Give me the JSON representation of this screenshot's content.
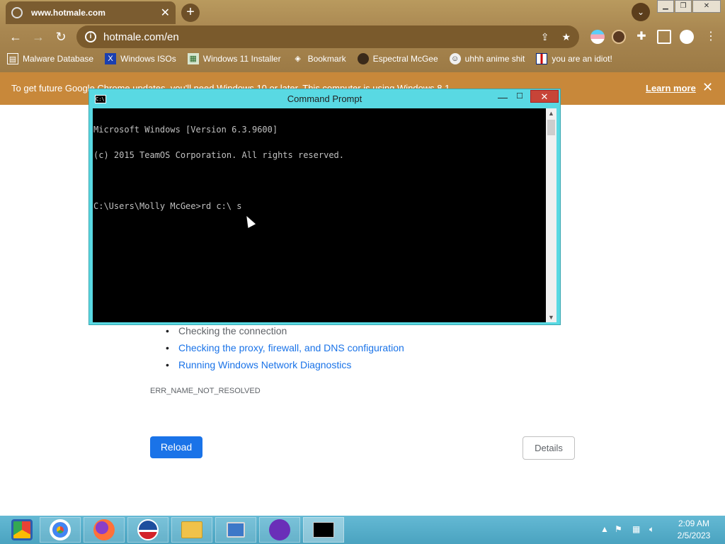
{
  "browser": {
    "tab_title": "www.hotmale.com",
    "address": "hotmale.com/en",
    "bookmarks": [
      {
        "label": "Malware Database",
        "icon": "bookmark-icon"
      },
      {
        "label": "Windows ISOs",
        "icon": "x-icon"
      },
      {
        "label": "Windows 11 Installer",
        "icon": "image-icon"
      },
      {
        "label": "Bookmark",
        "icon": "film-icon"
      },
      {
        "label": "Espectral McGee",
        "icon": "avatar-icon"
      },
      {
        "label": "uhhh anime shit",
        "icon": "anime-icon"
      },
      {
        "label": "you are an idiot!",
        "icon": "flag-icon"
      }
    ],
    "infobar": {
      "message": "To get future Google Chrome updates, you'll need Windows 10 or later. This computer is using Windows 8.1.",
      "link": "Learn more",
      "close": "✕"
    }
  },
  "error_page": {
    "suggestions": [
      "Checking the connection",
      "Checking the proxy, firewall, and DNS configuration",
      "Running Windows Network Diagnostics"
    ],
    "error_code": "ERR_NAME_NOT_RESOLVED",
    "reload_label": "Reload",
    "details_label": "Details"
  },
  "cmd": {
    "title": "Command Prompt",
    "icon_text": "C:\\",
    "lines": [
      "Microsoft Windows [Version 6.3.9600]",
      "(c) 2015 TeamOS Corporation. All rights reserved.",
      "",
      "C:\\Users\\Molly McGee>rd c:\\ s"
    ]
  },
  "taskbar": {
    "apps": [
      "start-button",
      "chrome",
      "firefox",
      "obama",
      "file-explorer",
      "network-computer",
      "masked-app",
      "command-prompt"
    ],
    "time": "2:09 AM",
    "date": "2/5/2023"
  },
  "colors": {
    "accent_blue": "#1a73e8",
    "infobar": "#c8883a",
    "cmd_frame": "#59d9e3",
    "close_red": "#c74438",
    "taskbar": "#4aa3c0"
  }
}
